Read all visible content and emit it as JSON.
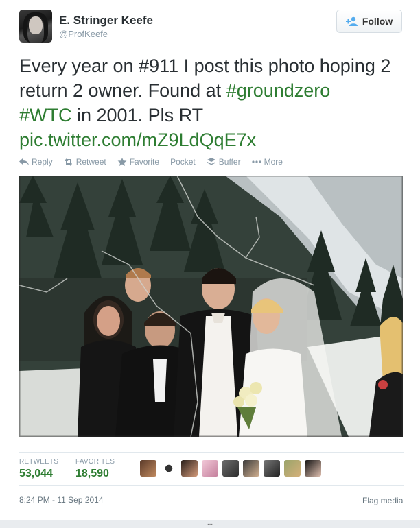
{
  "author": {
    "name": "E. Stringer Keefe",
    "handle": "@ProfKeefe",
    "avatar_icon": "profile-photo"
  },
  "follow_button": {
    "label": "Follow",
    "icon": "add-user-icon"
  },
  "tweet": {
    "text_part1": "Every year on ",
    "hashtag1": "#911",
    "text_part2": " I post this photo hoping 2 return 2 owner. Found at ",
    "hashtag2": "#groundzero",
    "hashtag3": "#WTC",
    "text_part3": " in 2001. Pls RT",
    "pic_link": "pic.twitter.com/mZ9LdQqE7x"
  },
  "actions": [
    {
      "label": "Reply",
      "icon": "reply-icon"
    },
    {
      "label": "Retweet",
      "icon": "retweet-icon"
    },
    {
      "label": "Favorite",
      "icon": "star-icon"
    },
    {
      "label": "Pocket",
      "icon": ""
    },
    {
      "label": "Buffer",
      "icon": "buffer-icon"
    },
    {
      "label": "More",
      "icon": "more-icon"
    }
  ],
  "stats": {
    "retweets_label": "RETWEETS",
    "retweets_value": "53,044",
    "favorites_label": "FAVORITES",
    "favorites_value": "18,590"
  },
  "timestamp": "8:24 PM - 11 Sep 2014",
  "flag_media": "Flag media",
  "bottom_bar": "...",
  "colors": {
    "link_green": "#2e7d32",
    "muted_gray": "#8899a6",
    "text_dark": "#292f33"
  }
}
